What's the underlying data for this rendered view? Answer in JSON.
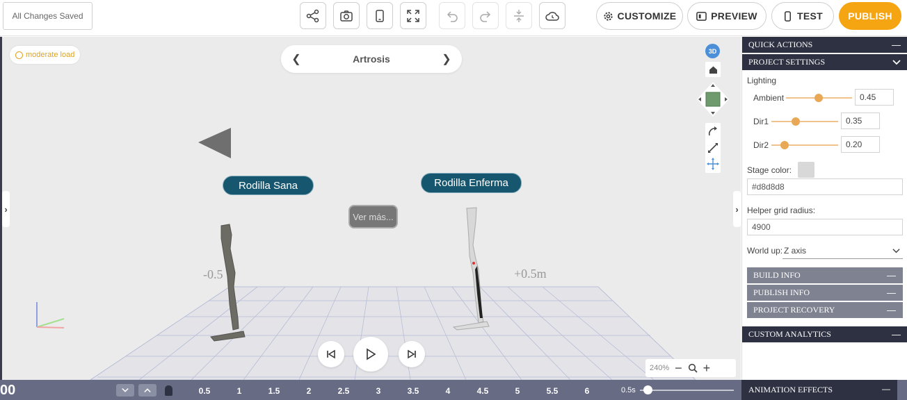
{
  "colors": {
    "accent": "#f5a511",
    "panel_header": "#2d3142",
    "sub_header": "#7f8391",
    "timeline": "#676c84",
    "stage": "#ebebeb",
    "label_bg": "#16566e",
    "slider": "#e8a855"
  },
  "toolbar": {
    "save_status": "All Changes Saved",
    "icons": [
      "share-icon",
      "camera-icon",
      "mobile-icon",
      "fullscreen-icon",
      "undo-icon",
      "redo-icon",
      "compress-icon",
      "cloud-icon"
    ],
    "customize_label": "CUSTOMIZE",
    "preview_label": "PREVIEW",
    "test_label": "TEST",
    "publish_label": "PUBLISH"
  },
  "viewport": {
    "load_badge": "moderate load",
    "scene_title": "Artrosis",
    "label_left": "Rodilla Sana",
    "label_right": "Rodilla Enferma",
    "ver_mas": "Ver más...",
    "axis_left": "-0.5",
    "axis_right": "+0.5m",
    "gizmo_3d": "3D",
    "zoom_level": "240%"
  },
  "panel": {
    "quick_actions": "QUICK ACTIONS",
    "project_settings": "PROJECT SETTINGS",
    "lighting": "Lighting",
    "ambient_label": "Ambient",
    "ambient_value": "0.45",
    "ambient_level": 0.45,
    "dir1_label": "Dir1",
    "dir1_value": "0.35",
    "dir1_level": 0.35,
    "dir2_label": "Dir2",
    "dir2_value": "0.20",
    "dir2_level": 0.2,
    "stage_color_label": "Stage color:",
    "stage_color_value": "#d8d8d8",
    "grid_radius_label": "Helper grid radius:",
    "grid_radius_value": "4900",
    "world_up_label": "World up:",
    "world_up_value": "Z axis",
    "build_info": "BUILD INFO",
    "publish_info": "PUBLISH INFO",
    "project_recovery": "PROJECT RECOVERY",
    "custom_analytics": "CUSTOM ANALYTICS"
  },
  "timeline": {
    "time": "00",
    "ticks": [
      "0.5",
      "1",
      "1.5",
      "2",
      "2.5",
      "3",
      "3.5",
      "4",
      "4.5",
      "5",
      "5.5",
      "6"
    ],
    "speed": "0.5s",
    "animation_effects": "ANIMATION EFFECTS"
  }
}
